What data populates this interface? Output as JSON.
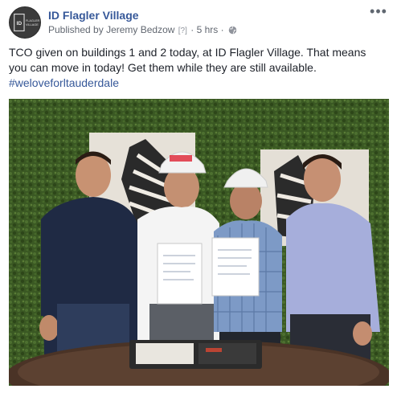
{
  "post": {
    "page_name": "ID Flagler Village",
    "publisher_prefix": "Published by",
    "publisher_name": "Jeremy Bedzow",
    "help_mark": "[?]",
    "separator": "·",
    "time": "5 hrs",
    "separator2": "·",
    "privacy_icon": "globe-icon",
    "more_icon": "more-options-icon",
    "more_label": "•••",
    "text_line": "TCO given on buildings 1 and 2 today, at ID Flagler Village. That means you can move in today! Get them while they are still available.",
    "hashtag": "#weloveforltauderdale",
    "avatar_logo_lines": [
      "ID",
      "FLAGLER",
      "VILLAGE"
    ]
  },
  "colors": {
    "link_blue": "#365899",
    "meta_gray": "#616770",
    "text": "#1d2129",
    "hedge_green": "#3c5a24"
  }
}
